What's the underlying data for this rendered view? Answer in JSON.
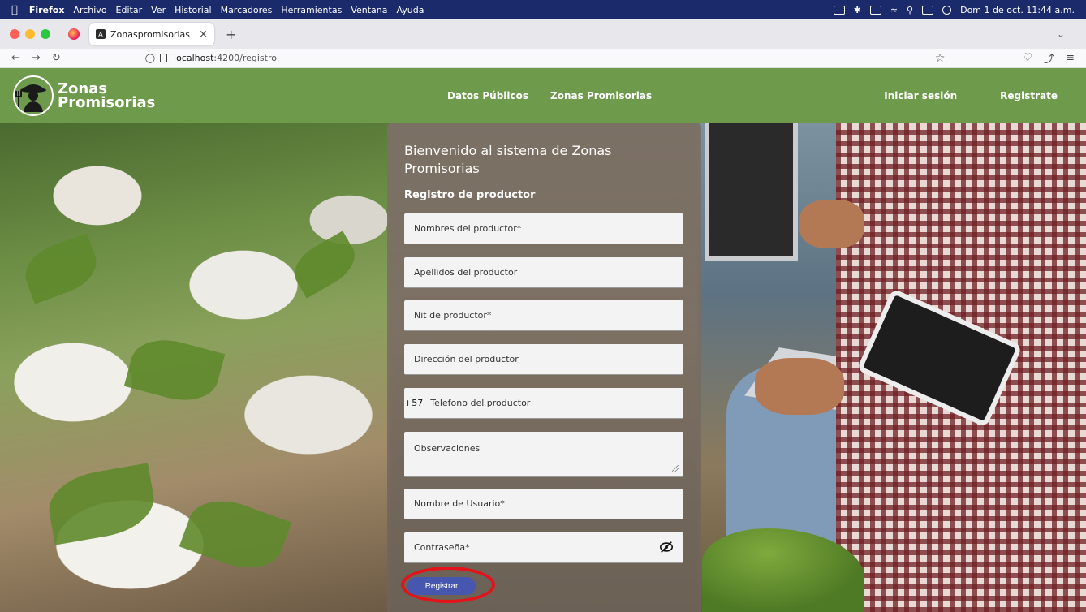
{
  "menubar": {
    "app": "Firefox",
    "items": [
      "Archivo",
      "Editar",
      "Ver",
      "Historial",
      "Marcadores",
      "Herramientas",
      "Ventana",
      "Ayuda"
    ],
    "clock": "Dom 1 de oct.  11:44 a.m."
  },
  "browser": {
    "tab_title": "Zonaspromisorias",
    "tab_close": "×",
    "new_tab": "+",
    "url_host": "localhost",
    "url_path": ":4200/registro"
  },
  "header": {
    "logo_line1": "Zonas",
    "logo_line2": "Promisorias",
    "nav": [
      "Datos Públicos",
      "Zonas Promisorias"
    ],
    "login": "Iniciar sesión",
    "register": "Registrate",
    "brand_color": "#6e9a4c"
  },
  "form": {
    "title": "Bienvenido al sistema de Zonas Promisorias",
    "subtitle": "Registro de productor",
    "fields": {
      "nombres": "Nombres del productor*",
      "apellidos": "Apellidos del productor",
      "nit": "Nit de productor*",
      "direccion": "Dirección del productor",
      "phone_prefix": "+57",
      "telefono": "Telefono del productor",
      "observaciones": "Observaciones",
      "usuario": "Nombre de Usuario*",
      "contrasena": "Contraseña*"
    },
    "submit": "Registrar",
    "button_color": "#4757b0",
    "highlight_color": "#e0141a"
  },
  "icons": [
    "apple-icon",
    "firefox-icon",
    "angular-favicon-icon",
    "shield-icon",
    "page-icon",
    "star-icon",
    "eye-slash-icon",
    "farmer-logo-icon"
  ]
}
